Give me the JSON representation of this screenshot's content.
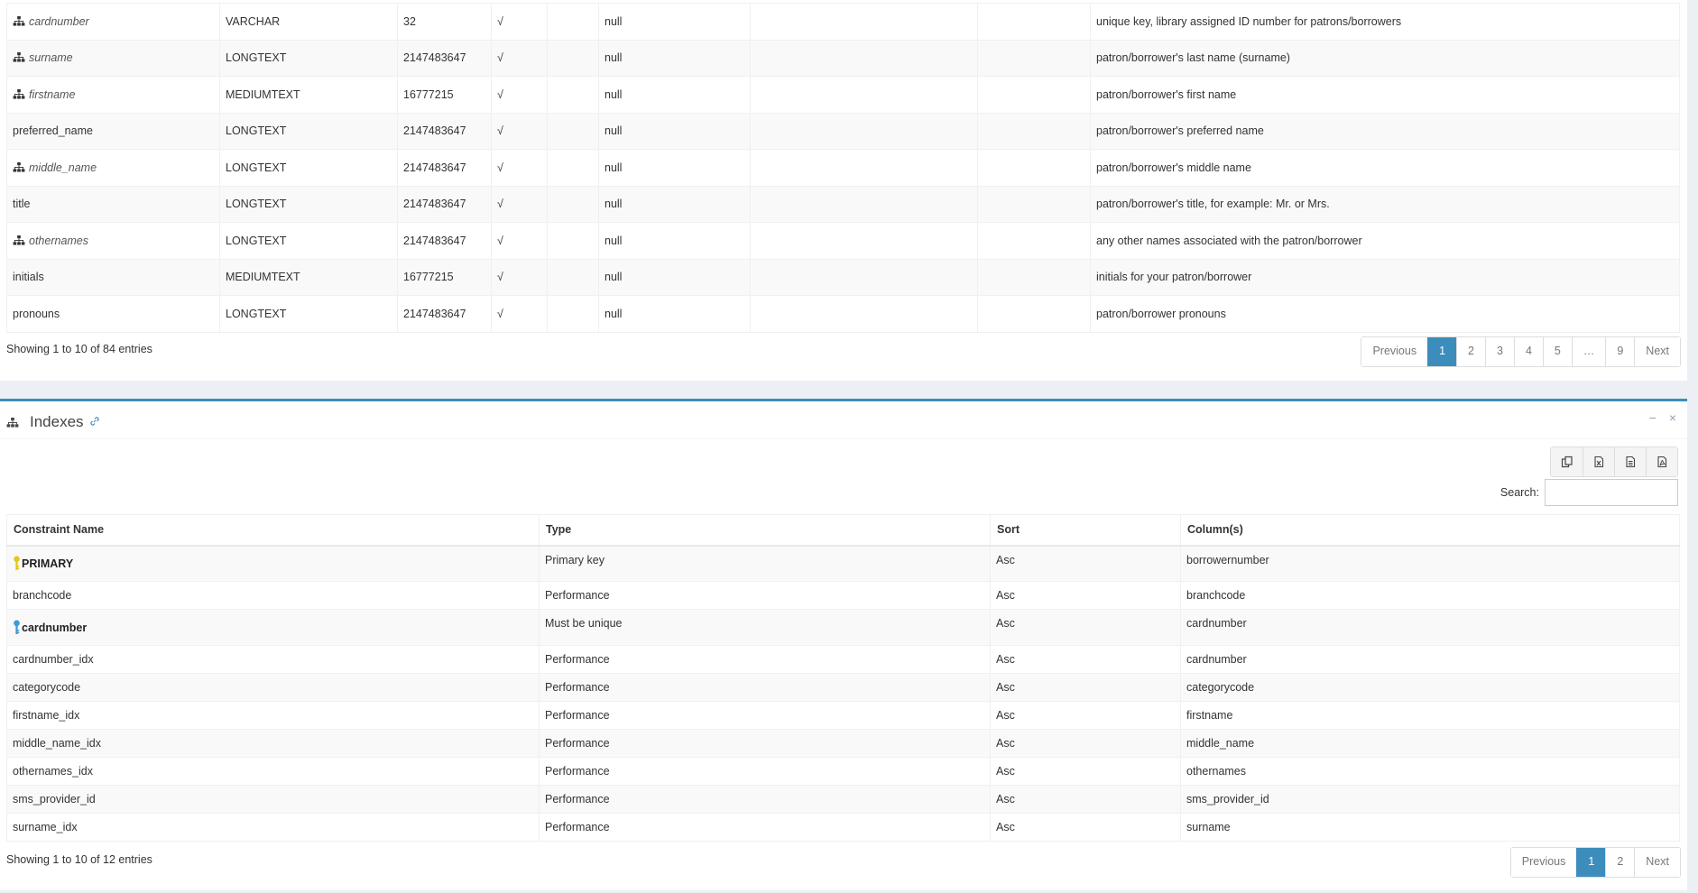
{
  "columns_table": {
    "rows": [
      {
        "name": "cardnumber",
        "indexed": true,
        "type": "VARCHAR",
        "length": "32",
        "nullable": "√",
        "default": "null",
        "comment": "unique key, library assigned ID number for patrons/borrowers"
      },
      {
        "name": "surname",
        "indexed": true,
        "type": "LONGTEXT",
        "length": "2147483647",
        "nullable": "√",
        "default": "null",
        "comment": "patron/borrower's last name (surname)"
      },
      {
        "name": "firstname",
        "indexed": true,
        "type": "MEDIUMTEXT",
        "length": "16777215",
        "nullable": "√",
        "default": "null",
        "comment": "patron/borrower's first name"
      },
      {
        "name": "preferred_name",
        "indexed": false,
        "type": "LONGTEXT",
        "length": "2147483647",
        "nullable": "√",
        "default": "null",
        "comment": "patron/borrower's preferred name"
      },
      {
        "name": "middle_name",
        "indexed": true,
        "type": "LONGTEXT",
        "length": "2147483647",
        "nullable": "√",
        "default": "null",
        "comment": "patron/borrower's middle name"
      },
      {
        "name": "title",
        "indexed": false,
        "type": "LONGTEXT",
        "length": "2147483647",
        "nullable": "√",
        "default": "null",
        "comment": "patron/borrower's title, for example: Mr. or Mrs."
      },
      {
        "name": "othernames",
        "indexed": true,
        "type": "LONGTEXT",
        "length": "2147483647",
        "nullable": "√",
        "default": "null",
        "comment": "any other names associated with the patron/borrower"
      },
      {
        "name": "initials",
        "indexed": false,
        "type": "MEDIUMTEXT",
        "length": "16777215",
        "nullable": "√",
        "default": "null",
        "comment": "initials for your patron/borrower"
      },
      {
        "name": "pronouns",
        "indexed": false,
        "type": "LONGTEXT",
        "length": "2147483647",
        "nullable": "√",
        "default": "null",
        "comment": "patron/borrower pronouns"
      }
    ],
    "info": "Showing 1 to 10 of 84 entries",
    "pagination": {
      "previous": "Previous",
      "pages": [
        "1",
        "2",
        "3",
        "4",
        "5",
        "…",
        "9"
      ],
      "active": "1",
      "next": "Next"
    }
  },
  "indexes_box": {
    "title": "Indexes",
    "title_icon": "sitemap-icon",
    "link_icon": "link-icon",
    "tools": {
      "collapse": "−",
      "close": "×"
    },
    "export_buttons": [
      "copy-icon",
      "excel-icon",
      "csv-icon",
      "pdf-icon"
    ],
    "search_label": "Search:",
    "search_value": "",
    "headers": [
      "Constraint Name",
      "Type",
      "Sort",
      "Column(s)"
    ],
    "rows": [
      {
        "name": "PRIMARY",
        "key": "primary",
        "type": "Primary key",
        "sort": "Asc",
        "columns": "borrowernumber"
      },
      {
        "name": "branchcode",
        "key": "",
        "type": "Performance",
        "sort": "Asc",
        "columns": "branchcode"
      },
      {
        "name": "cardnumber",
        "key": "unique",
        "type": "Must be unique",
        "sort": "Asc",
        "columns": "cardnumber"
      },
      {
        "name": "cardnumber_idx",
        "key": "",
        "type": "Performance",
        "sort": "Asc",
        "columns": "cardnumber"
      },
      {
        "name": "categorycode",
        "key": "",
        "type": "Performance",
        "sort": "Asc",
        "columns": "categorycode"
      },
      {
        "name": "firstname_idx",
        "key": "",
        "type": "Performance",
        "sort": "Asc",
        "columns": "firstname"
      },
      {
        "name": "middle_name_idx",
        "key": "",
        "type": "Performance",
        "sort": "Asc",
        "columns": "middle_name"
      },
      {
        "name": "othernames_idx",
        "key": "",
        "type": "Performance",
        "sort": "Asc",
        "columns": "othernames"
      },
      {
        "name": "sms_provider_id",
        "key": "",
        "type": "Performance",
        "sort": "Asc",
        "columns": "sms_provider_id"
      },
      {
        "name": "surname_idx",
        "key": "",
        "type": "Performance",
        "sort": "Asc",
        "columns": "surname"
      }
    ],
    "info": "Showing 1 to 10 of 12 entries",
    "pagination": {
      "previous": "Previous",
      "pages": [
        "1",
        "2"
      ],
      "active": "1",
      "next": "Next"
    }
  },
  "colors": {
    "accent": "#3c8dbc",
    "primary_key": "#e6c619",
    "unique_key": "#3c9ad6"
  }
}
